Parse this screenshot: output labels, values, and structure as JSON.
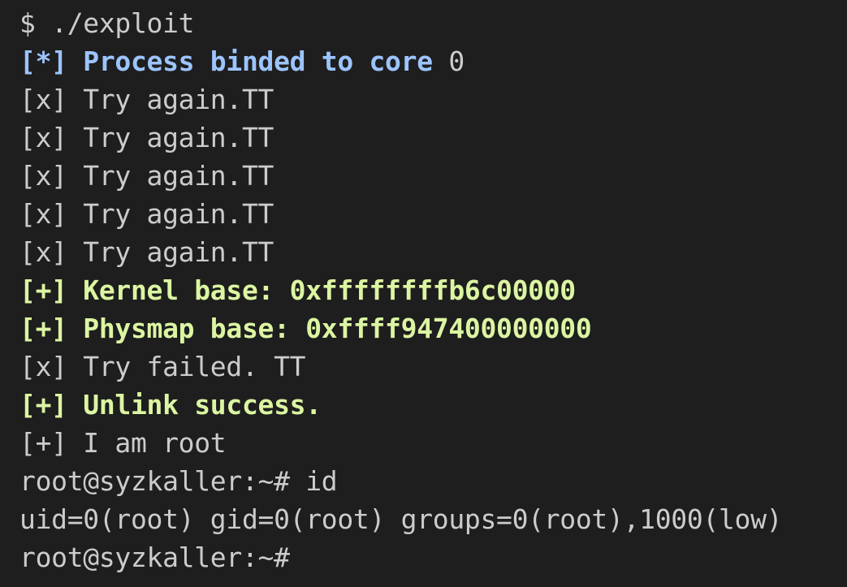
{
  "terminal": {
    "colors": {
      "background": "#1e1e1e",
      "default_text": "#cccccc",
      "info_blue": "#9cc4ff",
      "success_green": "#dcf5a2"
    },
    "lines": [
      {
        "text": "$ ./exploit"
      },
      {
        "prefix": "[*] Process binded to core ",
        "suffix": "0"
      },
      {
        "text": "[x] Try again.TT"
      },
      {
        "text": "[x] Try again.TT"
      },
      {
        "text": "[x] Try again.TT"
      },
      {
        "text": "[x] Try again.TT"
      },
      {
        "text": "[x] Try again.TT"
      },
      {
        "text": "[+] Kernel base: 0xffffffffb6c00000"
      },
      {
        "text": "[+] Physmap base: 0xffff947400000000"
      },
      {
        "text": "[x] Try failed. TT"
      },
      {
        "text": "[+] Unlink success."
      },
      {
        "text": "[+] I am root"
      },
      {
        "text": "root@syzkaller:~# id"
      },
      {
        "text": "uid=0(root) gid=0(root) groups=0(root),1000(low)"
      },
      {
        "text": "root@syzkaller:~#"
      }
    ]
  }
}
